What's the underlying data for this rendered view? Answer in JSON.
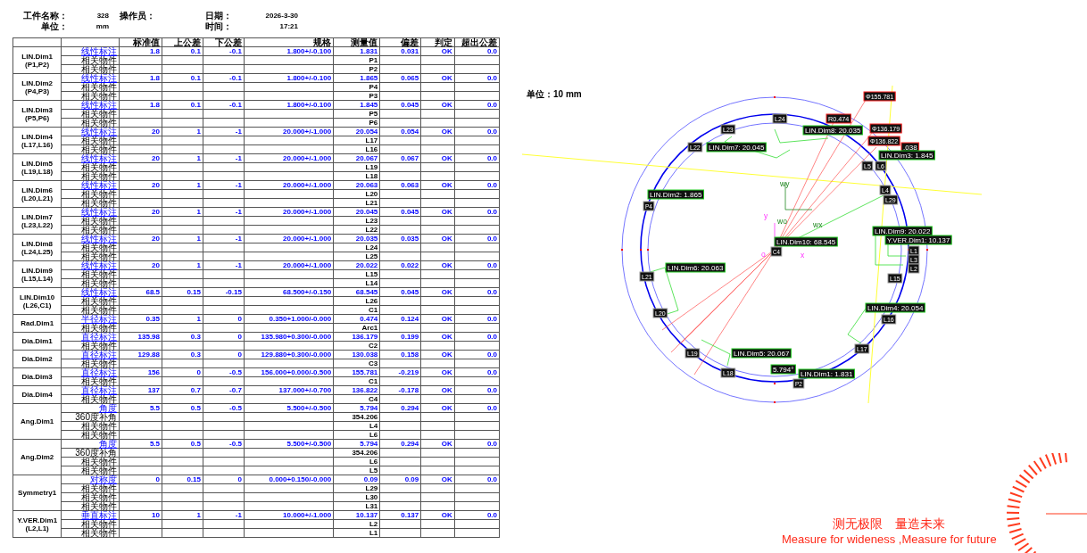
{
  "header": [
    {
      "label": "工件名称：",
      "value": "328"
    },
    {
      "label": "单位：",
      "value": "mm"
    },
    {
      "label": "操作员："
    },
    {
      "label": "日期：",
      "value": "2026-3-30"
    },
    {
      "label": "时间：",
      "value": "17:21"
    }
  ],
  "table": {
    "columns": [
      "标准值",
      "上公差",
      "下公差",
      "规格",
      "测量值",
      "偏差",
      "判定",
      "超出公差"
    ],
    "groups": [
      {
        "name": "LIN.Dim1",
        "refs": "(P1,P2)",
        "rows": [
          {
            "kind": "main",
            "label": "线性标注",
            "values": [
              "1.8",
              "0.1",
              "-0.1",
              "1.800+/-0.100",
              "1.831",
              "0.031",
              "OK",
              "0.0"
            ]
          },
          {
            "kind": "ref",
            "label": "相关物件",
            "measured": "P1"
          },
          {
            "kind": "ref",
            "label": "相关物件",
            "measured": "P2"
          }
        ]
      },
      {
        "name": "LIN.Dim2",
        "refs": "(P4,P3)",
        "rows": [
          {
            "kind": "main",
            "label": "线性标注",
            "values": [
              "1.8",
              "0.1",
              "-0.1",
              "1.800+/-0.100",
              "1.865",
              "0.065",
              "OK",
              "0.0"
            ]
          },
          {
            "kind": "ref",
            "label": "相关物件",
            "measured": "P4"
          },
          {
            "kind": "ref",
            "label": "相关物件",
            "measured": "P3"
          }
        ]
      },
      {
        "name": "LIN.Dim3",
        "refs": "(P5,P6)",
        "rows": [
          {
            "kind": "main",
            "label": "线性标注",
            "values": [
              "1.8",
              "0.1",
              "-0.1",
              "1.800+/-0.100",
              "1.845",
              "0.045",
              "OK",
              "0.0"
            ]
          },
          {
            "kind": "ref",
            "label": "相关物件",
            "measured": "P5"
          },
          {
            "kind": "ref",
            "label": "相关物件",
            "measured": "P6"
          }
        ]
      },
      {
        "name": "LIN.Dim4",
        "refs": "(L17,L16)",
        "rows": [
          {
            "kind": "main",
            "label": "线性标注",
            "values": [
              "20",
              "1",
              "-1",
              "20.000+/-1.000",
              "20.054",
              "0.054",
              "OK",
              "0.0"
            ]
          },
          {
            "kind": "ref",
            "label": "相关物件",
            "measured": "L17"
          },
          {
            "kind": "ref",
            "label": "相关物件",
            "measured": "L16"
          }
        ]
      },
      {
        "name": "LIN.Dim5",
        "refs": "(L19,L18)",
        "rows": [
          {
            "kind": "main",
            "label": "线性标注",
            "values": [
              "20",
              "1",
              "-1",
              "20.000+/-1.000",
              "20.067",
              "0.067",
              "OK",
              "0.0"
            ]
          },
          {
            "kind": "ref",
            "label": "相关物件",
            "measured": "L19"
          },
          {
            "kind": "ref",
            "label": "相关物件",
            "measured": "L18"
          }
        ]
      },
      {
        "name": "LIN.Dim6",
        "refs": "(L20,L21)",
        "rows": [
          {
            "kind": "main",
            "label": "线性标注",
            "values": [
              "20",
              "1",
              "-1",
              "20.000+/-1.000",
              "20.063",
              "0.063",
              "OK",
              "0.0"
            ]
          },
          {
            "kind": "ref",
            "label": "相关物件",
            "measured": "L20"
          },
          {
            "kind": "ref",
            "label": "相关物件",
            "measured": "L21"
          }
        ]
      },
      {
        "name": "LIN.Dim7",
        "refs": "(L23,L22)",
        "rows": [
          {
            "kind": "main",
            "label": "线性标注",
            "values": [
              "20",
              "1",
              "-1",
              "20.000+/-1.000",
              "20.045",
              "0.045",
              "OK",
              "0.0"
            ]
          },
          {
            "kind": "ref",
            "label": "相关物件",
            "measured": "L23"
          },
          {
            "kind": "ref",
            "label": "相关物件",
            "measured": "L22"
          }
        ]
      },
      {
        "name": "LIN.Dim8",
        "refs": "(L24,L25)",
        "rows": [
          {
            "kind": "main",
            "label": "线性标注",
            "values": [
              "20",
              "1",
              "-1",
              "20.000+/-1.000",
              "20.035",
              "0.035",
              "OK",
              "0.0"
            ]
          },
          {
            "kind": "ref",
            "label": "相关物件",
            "measured": "L24"
          },
          {
            "kind": "ref",
            "label": "相关物件",
            "measured": "L25"
          }
        ]
      },
      {
        "name": "LIN.Dim9",
        "refs": "(L15,L14)",
        "rows": [
          {
            "kind": "main",
            "label": "线性标注",
            "values": [
              "20",
              "1",
              "-1",
              "20.000+/-1.000",
              "20.022",
              "0.022",
              "OK",
              "0.0"
            ]
          },
          {
            "kind": "ref",
            "label": "相关物件",
            "measured": "L15"
          },
          {
            "kind": "ref",
            "label": "相关物件",
            "measured": "L14"
          }
        ]
      },
      {
        "name": "LIN.Dim10",
        "refs": "(L26,C1)",
        "rows": [
          {
            "kind": "main",
            "label": "线性标注",
            "values": [
              "68.5",
              "0.15",
              "-0.15",
              "68.500+/-0.150",
              "68.545",
              "0.045",
              "OK",
              "0.0"
            ]
          },
          {
            "kind": "ref",
            "label": "相关物件",
            "measured": "L26"
          },
          {
            "kind": "ref",
            "label": "相关物件",
            "measured": "C1"
          }
        ]
      },
      {
        "name": "Rad.Dim1",
        "rows": [
          {
            "kind": "main",
            "label": "半径标注",
            "values": [
              "0.35",
              "1",
              "0",
              "0.350+1.000/-0.000",
              "0.474",
              "0.124",
              "OK",
              "0.0"
            ]
          },
          {
            "kind": "ref",
            "label": "相关物件",
            "measured": "Arc1"
          }
        ]
      },
      {
        "name": "Dia.Dim1",
        "rows": [
          {
            "kind": "main",
            "label": "直径标注",
            "values": [
              "135.98",
              "0.3",
              "0",
              "135.980+0.300/-0.000",
              "136.179",
              "0.199",
              "OK",
              "0.0"
            ]
          },
          {
            "kind": "ref",
            "label": "相关物件",
            "measured": "C2"
          }
        ]
      },
      {
        "name": "Dia.Dim2",
        "rows": [
          {
            "kind": "main",
            "label": "直径标注",
            "values": [
              "129.88",
              "0.3",
              "0",
              "129.880+0.300/-0.000",
              "130.038",
              "0.158",
              "OK",
              "0.0"
            ]
          },
          {
            "kind": "ref",
            "label": "相关物件",
            "measured": "C3"
          }
        ]
      },
      {
        "name": "Dia.Dim3",
        "rows": [
          {
            "kind": "main",
            "label": "直径标注",
            "values": [
              "156",
              "0",
              "-0.5",
              "156.000+0.000/-0.500",
              "155.781",
              "-0.219",
              "OK",
              "0.0"
            ]
          },
          {
            "kind": "ref",
            "label": "相关物件",
            "measured": "C1"
          }
        ]
      },
      {
        "name": "Dia.Dim4",
        "rows": [
          {
            "kind": "main",
            "label": "直径标注",
            "values": [
              "137",
              "0.7",
              "-0.7",
              "137.000+/-0.700",
              "136.822",
              "-0.178",
              "OK",
              "0.0"
            ]
          },
          {
            "kind": "ref",
            "label": "相关物件",
            "measured": "C4"
          }
        ]
      },
      {
        "name": "Ang.Dim1",
        "rows": [
          {
            "kind": "main",
            "label": "角度",
            "values": [
              "5.5",
              "0.5",
              "-0.5",
              "5.500+/-0.500",
              "5.794",
              "0.294",
              "OK",
              "0.0"
            ]
          },
          {
            "kind": "ref",
            "label": "360度补角",
            "measured": "354.206"
          },
          {
            "kind": "ref",
            "label": "相关物件",
            "measured": "L4"
          },
          {
            "kind": "ref",
            "label": "相关物件",
            "measured": "L6"
          }
        ]
      },
      {
        "name": "Ang.Dim2",
        "rows": [
          {
            "kind": "main",
            "label": "角度",
            "values": [
              "5.5",
              "0.5",
              "-0.5",
              "5.500+/-0.500",
              "5.794",
              "0.294",
              "OK",
              "0.0"
            ]
          },
          {
            "kind": "ref",
            "label": "360度补角",
            "measured": "354.206"
          },
          {
            "kind": "ref",
            "label": "相关物件",
            "measured": "L6"
          },
          {
            "kind": "ref",
            "label": "相关物件",
            "measured": "L5"
          }
        ]
      },
      {
        "name": "Symmetry1",
        "rows": [
          {
            "kind": "main",
            "label": "对称度",
            "values": [
              "0",
              "0.15",
              "0",
              "0.000+0.150/-0.000",
              "0.09",
              "0.09",
              "OK",
              "0.0"
            ]
          },
          {
            "kind": "ref",
            "label": "相关物件",
            "measured": "L29"
          },
          {
            "kind": "ref",
            "label": "相关物件",
            "measured": "L30"
          },
          {
            "kind": "ref",
            "label": "相关物件",
            "measured": "L31"
          }
        ]
      },
      {
        "name": "Y.VER.Dim1",
        "refs": "(L2,L1)",
        "rows": [
          {
            "kind": "main",
            "label": "垂直标注",
            "values": [
              "10",
              "1",
              "-1",
              "10.000+/-1.000",
              "10.137",
              "0.137",
              "OK",
              "0.0"
            ]
          },
          {
            "kind": "ref",
            "label": "相关物件",
            "measured": "L2"
          },
          {
            "kind": "ref",
            "label": "相关物件",
            "measured": "L1"
          }
        ]
      }
    ]
  },
  "drawing": {
    "unit_label": "单位：10 mm",
    "labels": [
      {
        "text": "Φ155.781",
        "kind": "dia"
      },
      {
        "text": "L24",
        "kind": "ref"
      },
      {
        "text": "R0.474",
        "kind": "dia"
      },
      {
        "text": "L23",
        "kind": "ref"
      },
      {
        "text": "LIN.Dim8: 20.035",
        "kind": "dim"
      },
      {
        "text": "Φ136.179",
        "kind": "dia"
      },
      {
        "text": "Φ136.822",
        "kind": "dia"
      },
      {
        "text": "L22",
        "kind": "ref"
      },
      {
        "text": "LIN.Dim7: 20.045",
        "kind": "dim"
      },
      {
        "text": ".038",
        "kind": "dia"
      },
      {
        "text": "LIN.Dim3: 1.845",
        "kind": "dim"
      },
      {
        "text": "L5",
        "kind": "ref"
      },
      {
        "text": "L6",
        "kind": "ref"
      },
      {
        "text": "wy",
        "kind": "axis_world"
      },
      {
        "text": "L4",
        "kind": "ref"
      },
      {
        "text": "LIN.Dim2: 1.865",
        "kind": "dim"
      },
      {
        "text": "L29",
        "kind": "ref"
      },
      {
        "text": "P4",
        "kind": "ref"
      },
      {
        "text": "y",
        "kind": "axis_part"
      },
      {
        "text": "wo",
        "kind": "axis_world"
      },
      {
        "text": "wx",
        "kind": "axis_world"
      },
      {
        "text": "LIN.Dim9: 20.022",
        "kind": "dim"
      },
      {
        "text": "Y.VER.Dim1: 10.137",
        "kind": "dim"
      },
      {
        "text": "LIN.Dim10: 68.545",
        "kind": "dim"
      },
      {
        "text": "L1",
        "kind": "ref"
      },
      {
        "text": "C4",
        "kind": "ref"
      },
      {
        "text": "o",
        "kind": "axis_part"
      },
      {
        "text": "x",
        "kind": "axis_part"
      },
      {
        "text": "L3",
        "kind": "ref"
      },
      {
        "text": "LIN.Dim6: 20.063",
        "kind": "dim"
      },
      {
        "text": "L2",
        "kind": "ref"
      },
      {
        "text": "L21",
        "kind": "ref"
      },
      {
        "text": "L15",
        "kind": "ref"
      },
      {
        "text": "LIN.Dim4: 20.054",
        "kind": "dim"
      },
      {
        "text": "L20",
        "kind": "ref"
      },
      {
        "text": "L16",
        "kind": "ref"
      },
      {
        "text": "L17",
        "kind": "ref"
      },
      {
        "text": "L19",
        "kind": "ref"
      },
      {
        "text": "LIN.Dim5: 20.067",
        "kind": "dim"
      },
      {
        "text": "5.794°",
        "kind": "dim"
      },
      {
        "text": "L18",
        "kind": "ref"
      },
      {
        "text": "LIN.Dim1: 1.831",
        "kind": "dim"
      },
      {
        "text": "P2",
        "kind": "ref"
      }
    ]
  },
  "slogan": {
    "chinese": "测无极限　量造未来",
    "english": "Measure for wideness ,Measure for future"
  }
}
